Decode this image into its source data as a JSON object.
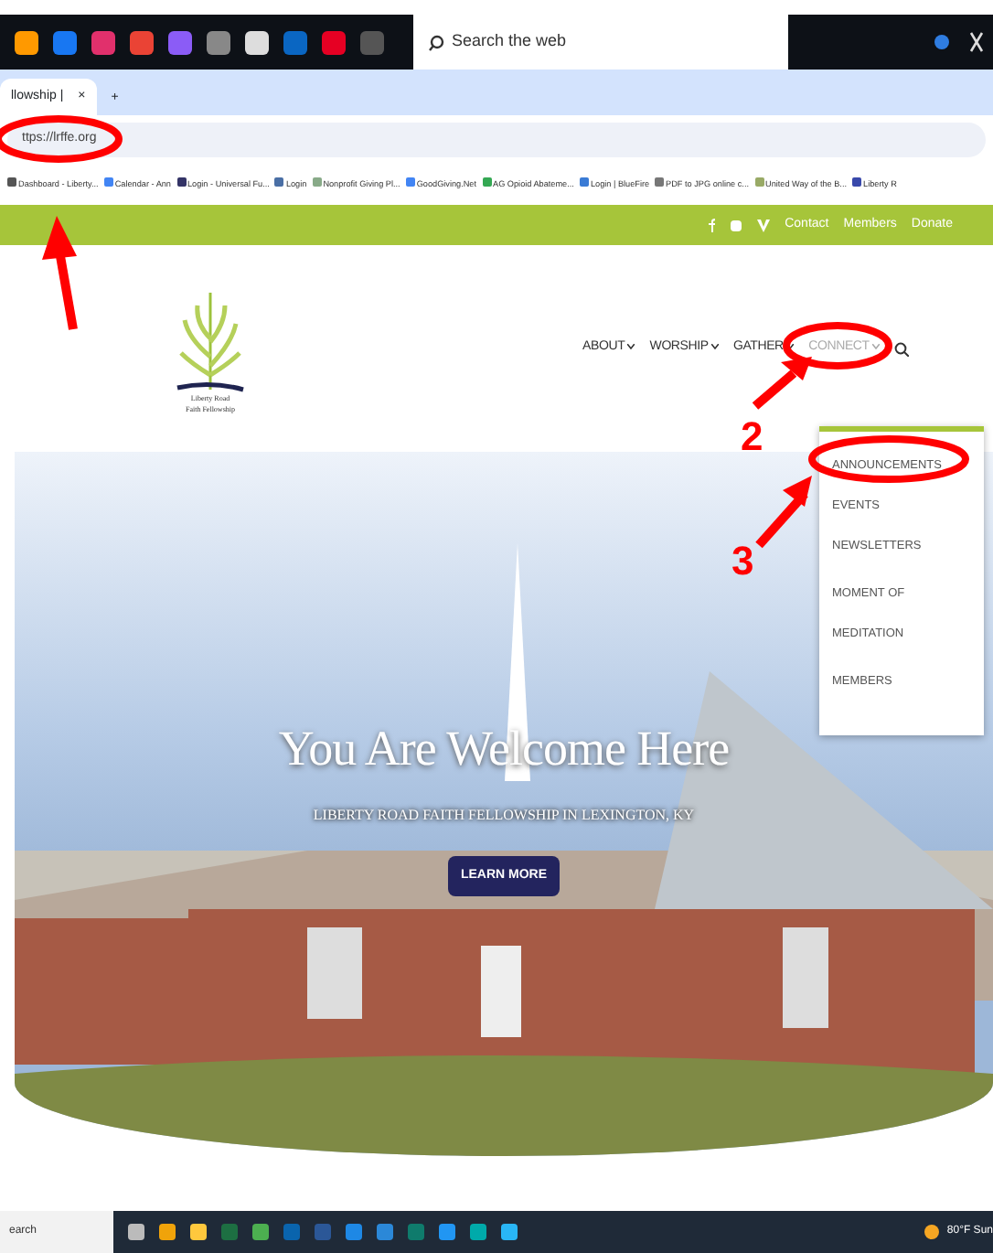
{
  "os_bar": {
    "search": {
      "placeholder": "Search the web"
    }
  },
  "browser": {
    "tab": {
      "title": "llowship |",
      "close": "×"
    },
    "new_tab": "+",
    "address": "ttps://lrffe.org",
    "bookmarks": [
      "Dashboard - Liberty...",
      "Calendar - Ann",
      "Login - Universal Fu...",
      "Login",
      "Nonprofit Giving Pl...",
      "GoodGiving.Net",
      "AG Opioid Abateme...",
      "Login | BlueFire",
      "PDF to JPG online c...",
      "United Way of the B...",
      "Liberty R"
    ]
  },
  "site": {
    "top_links": [
      "Contact",
      "Members",
      "Donate"
    ],
    "logo_text": [
      "Liberty Road",
      "Faith Fellowship"
    ],
    "nav": [
      {
        "label": "ABOUT",
        "selected": false
      },
      {
        "label": "WORSHIP",
        "selected": false
      },
      {
        "label": "GATHER",
        "selected": false
      },
      {
        "label": "CONNECT",
        "selected": true
      }
    ],
    "dropdown": [
      "ANNOUNCEMENTS",
      "EVENTS",
      "NEWSLETTERS",
      "MOMENT OF MEDITATION",
      "MEMBERS"
    ],
    "hero": {
      "title": "You Are Welcome Here",
      "subtitle": "LIBERTY ROAD FAITH FELLOWSHIP IN LEXINGTON, KY",
      "button": "LEARN MORE"
    }
  },
  "annotation_numbers": [
    "2",
    "3"
  ],
  "taskbar": {
    "search": "earch",
    "weather": "80°F Sun"
  }
}
